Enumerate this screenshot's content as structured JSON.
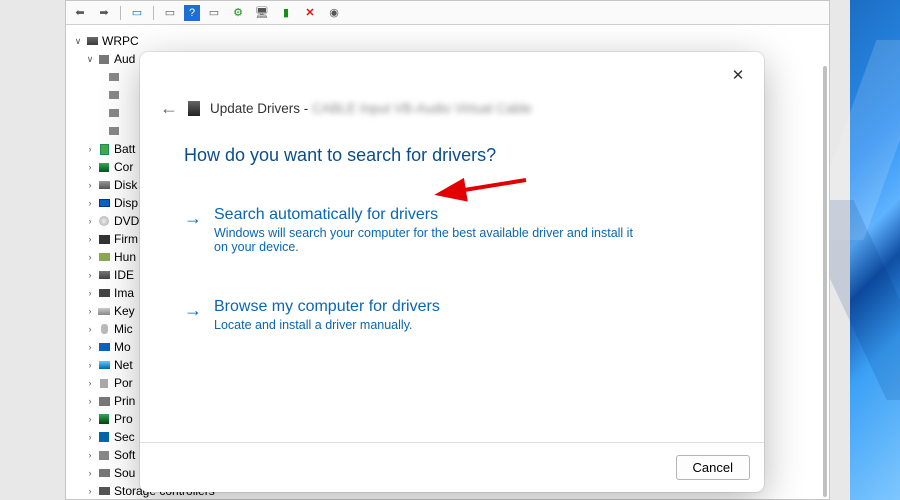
{
  "toolbar": {
    "back": "←",
    "fwd": "→"
  },
  "tree": {
    "root": "WRPC",
    "audio_root": "Aud",
    "categories": [
      {
        "label": "Batt",
        "icon": "ic-batt"
      },
      {
        "label": "Cor",
        "icon": "ic-chip"
      },
      {
        "label": "Disk",
        "icon": "ic-disk"
      },
      {
        "label": "Disp",
        "icon": "ic-disp"
      },
      {
        "label": "DVD",
        "icon": "ic-dvd"
      },
      {
        "label": "Firm",
        "icon": "ic-firm"
      },
      {
        "label": "Hun",
        "icon": "ic-hid"
      },
      {
        "label": "IDE",
        "icon": "ic-ide"
      },
      {
        "label": "Ima",
        "icon": "ic-img"
      },
      {
        "label": "Key",
        "icon": "ic-key"
      },
      {
        "label": "Mic",
        "icon": "ic-mouse"
      },
      {
        "label": "Mo",
        "icon": "ic-mon"
      },
      {
        "label": "Net",
        "icon": "ic-net"
      },
      {
        "label": "Por",
        "icon": "ic-port"
      },
      {
        "label": "Prin",
        "icon": "ic-print"
      },
      {
        "label": "Pro",
        "icon": "ic-cpu"
      },
      {
        "label": "Sec",
        "icon": "ic-sec"
      },
      {
        "label": "Soft",
        "icon": "ic-soft"
      },
      {
        "label": "Sou",
        "icon": "ic-sou"
      },
      {
        "label": "Storage controllers",
        "icon": "ic-sto"
      }
    ]
  },
  "dialog": {
    "title_prefix": "Update Drivers - ",
    "title_blurred": "CABLE Input VB-Audio Virtual Cable",
    "question": "How do you want to search for drivers?",
    "opt1_title": "Search automatically for drivers",
    "opt1_desc": "Windows will search your computer for the best available driver and install it on your device.",
    "opt2_title": "Browse my computer for drivers",
    "opt2_desc": "Locate and install a driver manually.",
    "cancel": "Cancel"
  }
}
